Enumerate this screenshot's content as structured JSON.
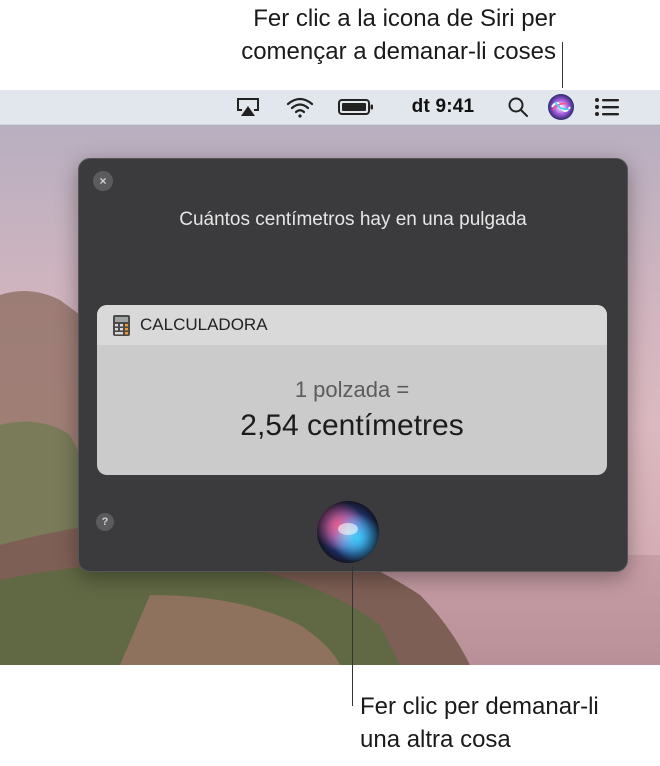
{
  "callouts": {
    "top_line1": "Fer clic a la icona de Siri per",
    "top_line2": "començar a demanar-li coses",
    "bottom_line1": "Fer clic per demanar-li",
    "bottom_line2": "una altra cosa"
  },
  "menubar": {
    "clock": "dt 9:41",
    "icons": [
      "airplay-icon",
      "wifi-icon",
      "battery-icon",
      "spotlight-search-icon",
      "siri-icon",
      "notification-center-icon"
    ]
  },
  "siri_window": {
    "close_label": "×",
    "query": "Cuántos centímetros hay en una pulgada",
    "card": {
      "app_name": "CALCULADORA",
      "line1": "1 polzada =",
      "line2": "2,54 centímetres"
    },
    "help_label": "?"
  },
  "colors": {
    "menubar": "#e2e7ee",
    "panel": "#3b3b3d",
    "card": "#cbcbcb"
  }
}
